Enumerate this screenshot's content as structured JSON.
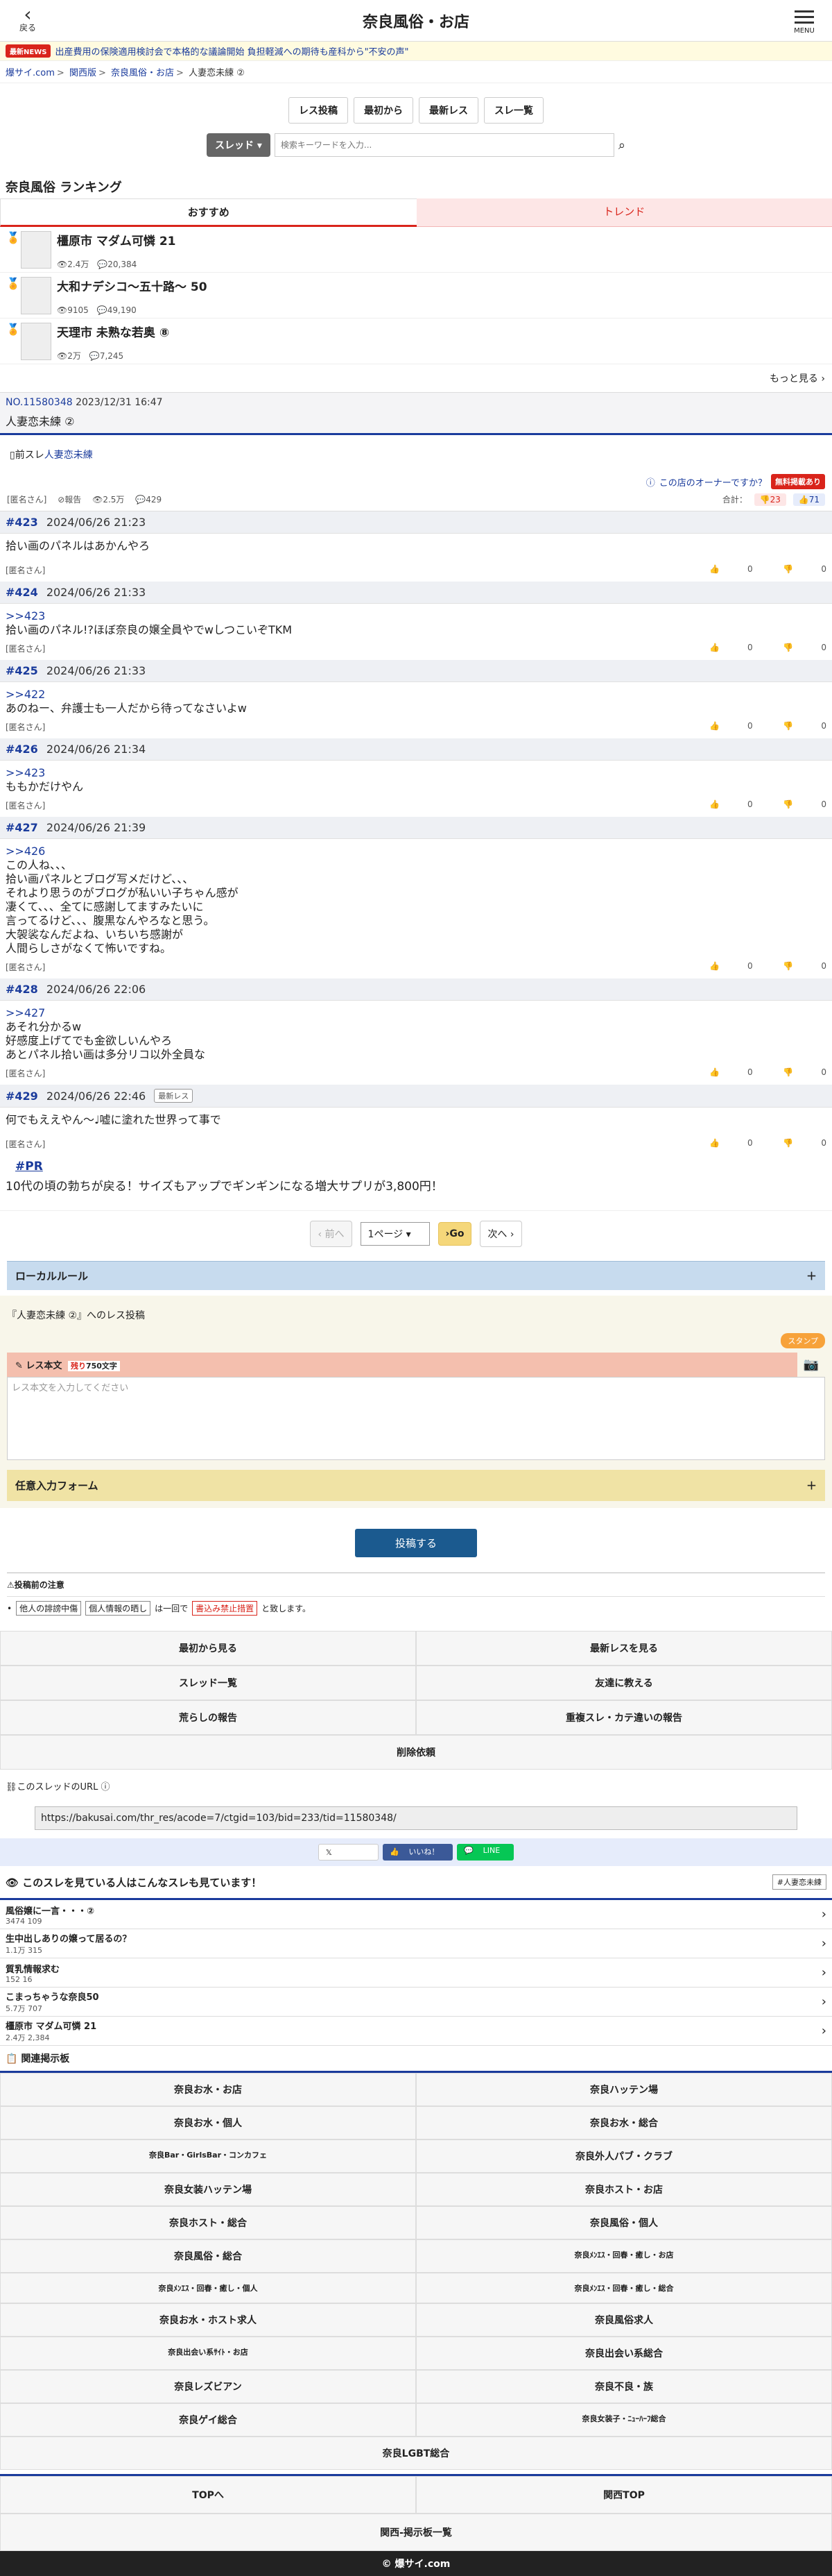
{
  "header": {
    "back_label": "戻る",
    "title": "奈良風俗・お店",
    "menu_label": "MENU"
  },
  "news": {
    "badge": "最新NEWS",
    "text": "出産費用の保険適用検討会で本格的な議論開始 負担軽減への期待も産科から\"不安の声\""
  },
  "breadcrumb": [
    "爆サイ.com",
    "関西版",
    "奈良風俗・お店",
    "人妻恋未練 ②"
  ],
  "toolbar": {
    "post": "レス投稿",
    "first": "最初から",
    "latest": "最新レス",
    "threads": "スレ一覧"
  },
  "search": {
    "select": "スレッド",
    "placeholder": "検索キーワードを入力..."
  },
  "ranking": {
    "title": "奈良風俗 ランキング",
    "tab_active": "おすすめ",
    "tab_inactive": "トレンド",
    "items": [
      {
        "name": "橿原市 マダム可憐 21",
        "views": "2.4万",
        "count": "20,384"
      },
      {
        "name": "大和ナデシコ〜五十路〜 50",
        "views": "9105",
        "count": "49,190"
      },
      {
        "name": "天理市 未熟な若奥 ⑧",
        "views": "2万",
        "count": "7,245"
      }
    ],
    "more": "もっと見る"
  },
  "thread": {
    "no": "NO.11580348",
    "date": "2023/12/31 16:47",
    "name": "人妻恋未練 ②",
    "prev_label": "前スレ",
    "prev_link": "人妻恋未練"
  },
  "owner": {
    "text": "この店のオーナーですか？",
    "badge": "無料掲載あり"
  },
  "stats": {
    "author": "[匿名さん]",
    "report": "報告",
    "views": "2.5万",
    "res": "429",
    "total_label": "合計：",
    "bad": "23",
    "good": "71"
  },
  "posts": [
    {
      "num": "#423",
      "date": "2024/06/26 21:23",
      "anchor": "",
      "body": "拾い画のパネルはあかんやろ",
      "author": "[匿名さん]",
      "good": "0",
      "bad": "0",
      "newest": ""
    },
    {
      "num": "#424",
      "date": "2024/06/26 21:33",
      "anchor": ">>423",
      "body": "拾い画のパネル!?ほぼ奈良の嬢全員やでwしつこいぞTKM",
      "author": "[匿名さん]",
      "good": "0",
      "bad": "0",
      "newest": ""
    },
    {
      "num": "#425",
      "date": "2024/06/26 21:33",
      "anchor": ">>422",
      "body": "あのねー、弁護士も一人だから待ってなさいよw",
      "author": "[匿名さん]",
      "good": "0",
      "bad": "0",
      "newest": ""
    },
    {
      "num": "#426",
      "date": "2024/06/26 21:34",
      "anchor": ">>423",
      "body": "ももかだけやん",
      "author": "[匿名さん]",
      "good": "0",
      "bad": "0",
      "newest": ""
    },
    {
      "num": "#427",
      "date": "2024/06/26 21:39",
      "anchor": ">>426",
      "body": "この人ね、、、\n拾い画パネルとブログ写メだけど、、、\nそれより思うのがブログが私いい子ちゃん感が\n凄くて、、、全てに感謝してますみたいに\n言ってるけど、、、腹黒なんやろなと思う。\n大袈裟なんだよね、いちいち感謝が\n人間らしさがなくて怖いですね。",
      "author": "[匿名さん]",
      "good": "0",
      "bad": "0",
      "newest": ""
    },
    {
      "num": "#428",
      "date": "2024/06/26 22:06",
      "anchor": ">>427",
      "body": "あそれ分かるw\n好感度上げてでも金欲しいんやろ\nあとパネル拾い画は多分リコ以外全員な",
      "author": "[匿名さん]",
      "good": "0",
      "bad": "0",
      "newest": ""
    },
    {
      "num": "#429",
      "date": "2024/06/26 22:46",
      "anchor": "",
      "body": "何でもええやん～♩嘘に塗れた世界って事で",
      "author": "[匿名さん]",
      "good": "0",
      "bad": "0",
      "newest": "最新レス"
    }
  ],
  "pr": {
    "tag": "#PR",
    "text": "10代の頃の勃ちが戻る！サイズもアップでギンギンになる増大サプリが3,800円！"
  },
  "pager": {
    "prev": "前へ",
    "page": "1ページ",
    "go": "Go",
    "next": "次へ"
  },
  "local_rule": "ローカルルール",
  "form": {
    "title": "『人妻恋未練 ②』へのレス投稿",
    "stamp": "スタンプ",
    "label": "レス本文",
    "remain": "残り",
    "remain_count": "750文字",
    "placeholder": "レス本文を入力してください",
    "optional": "任意入力フォーム",
    "submit": "投稿する"
  },
  "caution": {
    "title": "投稿前の注意",
    "b1": "他人の誹謗中傷",
    "b2": "個人情報の晒し",
    "t1": "は一回で",
    "red": "書込み禁止措置",
    "t2": "と致します。"
  },
  "actions": [
    "最初から見る",
    "最新レスを見る",
    "スレッド一覧",
    "友達に教える",
    "荒らしの報告",
    "重複スレ・カテ違いの報告",
    "削除依頼"
  ],
  "url": {
    "label": "このスレッドのURL",
    "value": "https://bakusai.com/thr_res/acode=7/ctgid=103/bid=233/tid=11580348/"
  },
  "share": {
    "x": "ポスト",
    "fb": "いいね！",
    "line": "LINE"
  },
  "others": {
    "title": "このスレを見ている人はこんなスレも見ています！",
    "tag": "#人妻恋未練",
    "items": [
      {
        "name": "風俗嬢に一言・・・②",
        "meta": "3474  109"
      },
      {
        "name": "生中出しありの嬢って居るの？",
        "meta": "1.1万  315"
      },
      {
        "name": "質乳情報求む",
        "meta": "152  16"
      },
      {
        "name": "こまっちゃうな奈良50",
        "meta": "5.7万  707"
      },
      {
        "name": "橿原市 マダム可憐 21",
        "meta": "2.4万  2,384"
      }
    ]
  },
  "related": {
    "title": "関連掲示板",
    "items": [
      "奈良お水・お店",
      "奈良ハッテン場",
      "奈良お水・個人",
      "奈良お水・総合",
      "奈良Bar・GirlsBar・コンカフェ",
      "奈良外人パブ・クラブ",
      "奈良女装ハッテン場",
      "奈良ホスト・お店",
      "奈良ホスト・総合",
      "奈良風俗・個人",
      "奈良風俗・総合",
      "奈良ﾒﾝｴｽ・回春・癒し・お店",
      "奈良ﾒﾝｴｽ・回春・癒し・個人",
      "奈良ﾒﾝｴｽ・回春・癒し・総合",
      "奈良お水・ホスト求人",
      "奈良風俗求人",
      "奈良出会い系ｻｲﾄ・お店",
      "奈良出会い系総合",
      "奈良レズビアン",
      "奈良不良・族",
      "奈良ゲイ総合",
      "奈良女装子・ﾆｭｰﾊｰﾌ総合",
      "奈良LGBT総合"
    ]
  },
  "bottom": {
    "top": "TOPへ",
    "kansai_top": "関西TOP",
    "list": "関西-掲示板一覧"
  },
  "footer": "© 爆サイ.com"
}
